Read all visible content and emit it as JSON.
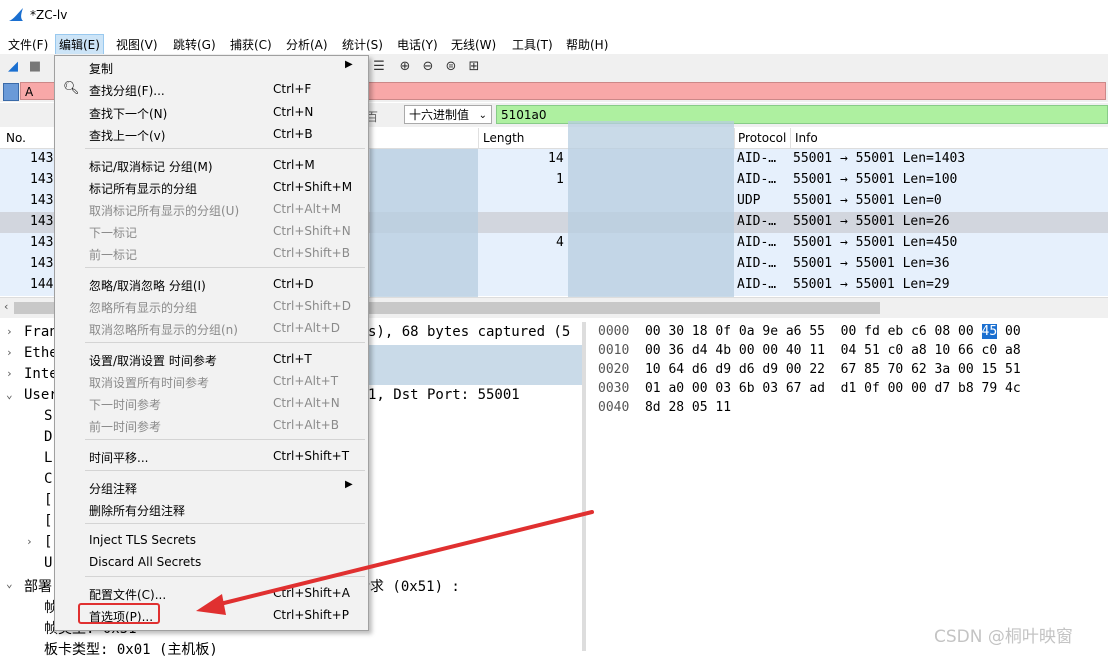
{
  "window": {
    "title": "*ZC-lv"
  },
  "menubar": [
    {
      "label": "文件(F)"
    },
    {
      "label": "编辑(E)"
    },
    {
      "label": "视图(V)"
    },
    {
      "label": "跳转(G)"
    },
    {
      "label": "捕获(C)"
    },
    {
      "label": "分析(A)"
    },
    {
      "label": "统计(S)"
    },
    {
      "label": "电话(Y)"
    },
    {
      "label": "无线(W)"
    },
    {
      "label": "工具(T)"
    },
    {
      "label": "帮助(H)"
    }
  ],
  "filter": {
    "value": "A"
  },
  "search": {
    "mode": "十六进制值",
    "value": "5101a0",
    "hint": "百"
  },
  "packet_list": {
    "headers": {
      "no": "No.",
      "length": "Length",
      "protocol": "Protocol",
      "info": "Info"
    },
    "rows": [
      {
        "no": "143",
        "len": "14",
        "proto": "AID-…",
        "info": "55001 → 55001 Len=1403"
      },
      {
        "no": "143",
        "len": "1",
        "proto": "AID-…",
        "info": "55001 → 55001 Len=100"
      },
      {
        "no": "143",
        "len": "",
        "proto": "UDP",
        "info": "55001 → 55001 Len=0"
      },
      {
        "no": "143",
        "len": "",
        "proto": "AID-…",
        "info": "55001 → 55001 Len=26"
      },
      {
        "no": "143",
        "len": "4",
        "proto": "AID-…",
        "info": "55001 → 55001 Len=450"
      },
      {
        "no": "143",
        "len": "",
        "proto": "AID-…",
        "info": "55001 → 55001 Len=36"
      },
      {
        "no": "144",
        "len": "",
        "proto": "AID-…",
        "info": "55001 → 55001 Len=29"
      }
    ]
  },
  "details": {
    "rows": [
      {
        "exp": "›",
        "text": "Fran",
        "tail": "s), 68 bytes captured (5"
      },
      {
        "exp": "›",
        "text": "Ethe",
        "tail": ""
      },
      {
        "exp": "›",
        "text": "Inte",
        "tail": ""
      },
      {
        "exp": "⌄",
        "text": "User",
        "tail": "1, Dst Port: 55001"
      },
      {
        "exp": "",
        "text": "  S",
        "tail": ""
      },
      {
        "exp": "",
        "text": "  D",
        "tail": ""
      },
      {
        "exp": "",
        "text": "  L",
        "tail": ""
      },
      {
        "exp": "",
        "text": "  C",
        "tail": ""
      },
      {
        "exp": "",
        "text": "  [",
        "tail": ""
      },
      {
        "exp": "",
        "text": "  [",
        "tail": ""
      },
      {
        "exp": "›",
        "text": "  [",
        "tail": ""
      },
      {
        "exp": "",
        "text": "  U",
        "tail": ""
      },
      {
        "exp": "⌄",
        "text": "部署",
        "tail": "次请求 (0x51) :"
      },
      {
        "exp": "",
        "text": "  帧",
        "tail": ""
      },
      {
        "exp": "",
        "text": "  帧类型: 0x51",
        "tail": ""
      },
      {
        "exp": "",
        "text": "  板卡类型: 0x01 (主机板)",
        "tail": ""
      }
    ]
  },
  "bytes": {
    "rows": [
      {
        "off": "0000",
        "hex1": "00 30 18 0f 0a 9e a6 55  00 fd eb c6 08 00 ",
        "hl": "45",
        "hex2": " 00"
      },
      {
        "off": "0010",
        "hex1": "00 36 d4 4b 00 00 40 11  04 51 c0 a8 10 66 c0 a8",
        "hl": "",
        "hex2": ""
      },
      {
        "off": "0020",
        "hex1": "10 64 d6 d9 d6 d9 00 22  67 85 70 62 3a 00 15 51",
        "hl": "",
        "hex2": ""
      },
      {
        "off": "0030",
        "hex1": "01 a0 00 03 6b 03 67 ad  d1 0f 00 00 d7 b8 79 4c",
        "hl": "",
        "hex2": ""
      },
      {
        "off": "0040",
        "hex1": "8d 28 05 11",
        "hl": "",
        "hex2": ""
      }
    ]
  },
  "edit_menu": {
    "items": [
      {
        "label": "复制",
        "shortcut": "",
        "submenu": true,
        "disabled": false
      },
      {
        "label": "查找分组(F)...",
        "shortcut": "Ctrl+F",
        "disabled": false,
        "icon": "search-icon"
      },
      {
        "label": "查找下一个(N)",
        "shortcut": "Ctrl+N",
        "disabled": false
      },
      {
        "label": "查找上一个(v)",
        "shortcut": "Ctrl+B",
        "disabled": false
      },
      {
        "label": "标记/取消标记 分组(M)",
        "shortcut": "Ctrl+M",
        "disabled": false
      },
      {
        "label": "标记所有显示的分组",
        "shortcut": "Ctrl+Shift+M",
        "disabled": false
      },
      {
        "label": "取消标记所有显示的分组(U)",
        "shortcut": "Ctrl+Alt+M",
        "disabled": true
      },
      {
        "label": "下一标记",
        "shortcut": "Ctrl+Shift+N",
        "disabled": true
      },
      {
        "label": "前一标记",
        "shortcut": "Ctrl+Shift+B",
        "disabled": true
      },
      {
        "label": "忽略/取消忽略 分组(I)",
        "shortcut": "Ctrl+D",
        "disabled": false
      },
      {
        "label": "忽略所有显示的分组",
        "shortcut": "Ctrl+Shift+D",
        "disabled": true
      },
      {
        "label": "取消忽略所有显示的分组(n)",
        "shortcut": "Ctrl+Alt+D",
        "disabled": true
      },
      {
        "label": "设置/取消设置 时间参考",
        "shortcut": "Ctrl+T",
        "disabled": false
      },
      {
        "label": "取消设置所有时间参考",
        "shortcut": "Ctrl+Alt+T",
        "disabled": true
      },
      {
        "label": "下一时间参考",
        "shortcut": "Ctrl+Alt+N",
        "disabled": true
      },
      {
        "label": "前一时间参考",
        "shortcut": "Ctrl+Alt+B",
        "disabled": true
      },
      {
        "label": "时间平移...",
        "shortcut": "Ctrl+Shift+T",
        "disabled": false
      },
      {
        "label": "分组注释",
        "shortcut": "",
        "submenu": true,
        "disabled": false
      },
      {
        "label": "删除所有分组注释",
        "shortcut": "",
        "disabled": false
      },
      {
        "label": "Inject TLS Secrets",
        "shortcut": "",
        "disabled": false
      },
      {
        "label": "Discard All Secrets",
        "shortcut": "",
        "disabled": false
      },
      {
        "label": "配置文件(C)...",
        "shortcut": "Ctrl+Shift+A",
        "disabled": false
      },
      {
        "label": "首选项(P)...",
        "shortcut": "Ctrl+Shift+P",
        "disabled": false
      }
    ]
  },
  "watermark": "CSDN @桐叶映窗",
  "colors": {
    "filter_bg": "#f8a8a8",
    "search_bg": "#aef0a0",
    "row_bg": "#e6f0fc",
    "annotation": "#e03030"
  }
}
